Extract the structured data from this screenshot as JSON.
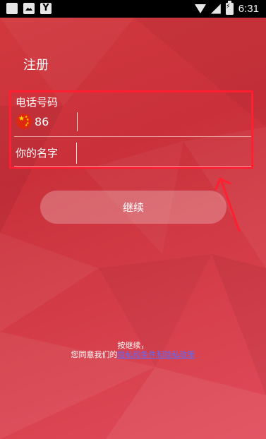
{
  "status_bar": {
    "time": "6:31",
    "left_icons": [
      "square-icon",
      "image-icon",
      "y-app-icon"
    ],
    "right_icons": [
      "wifi-icon",
      "signal-icon",
      "battery-icon"
    ]
  },
  "page": {
    "title": "注册"
  },
  "phone": {
    "label": "电话号码",
    "country_flag": "china-flag-icon",
    "country_code": "86",
    "value": ""
  },
  "name": {
    "label": "你的名字",
    "value": ""
  },
  "actions": {
    "continue_label": "继续"
  },
  "terms": {
    "line1": "按继续，",
    "line2_prefix": "您同意我们的",
    "link_text": "隐私和条件和隐私政策"
  },
  "colors": {
    "background": "#d23a3f",
    "highlight": "#ff1f30",
    "link": "#5a6cff"
  }
}
